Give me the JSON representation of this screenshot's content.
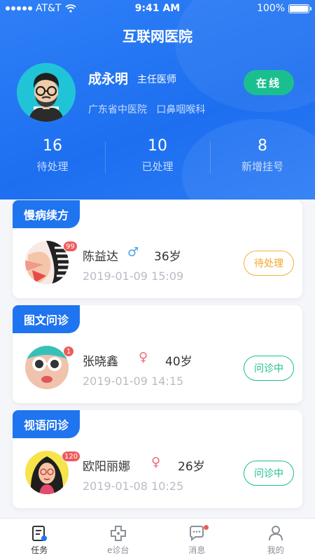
{
  "status_bar": {
    "carrier": "AT&T",
    "time": "9:41 AM",
    "battery": "100%"
  },
  "app": {
    "title": "互联网医院"
  },
  "doctor": {
    "name": "成永明",
    "title": "主任医师",
    "hospital": "广东省中医院",
    "department": "口鼻咽喉科",
    "status_label": "在线"
  },
  "stats": [
    {
      "value": "16",
      "label": "待处理"
    },
    {
      "value": "10",
      "label": "已处理"
    },
    {
      "value": "8",
      "label": "新增挂号"
    }
  ],
  "cards": [
    {
      "category": "慢病续方",
      "badge": "99",
      "name": "陈益达",
      "gender": "♂",
      "gender_color": "#4ea3e8",
      "age": "36岁",
      "datetime": "2019-01-09   15:09",
      "status": "待处理"
    },
    {
      "category": "图文问诊",
      "badge": "1",
      "name": "张晓鑫",
      "gender": "♀",
      "gender_color": "#ef6a7a",
      "age": "40岁",
      "datetime": "2019-01-09   14:15",
      "status": "问诊中"
    },
    {
      "category": "视语问诊",
      "badge": "120",
      "name": "欧阳丽娜",
      "gender": "♀",
      "gender_color": "#ef6a7a",
      "age": "26岁",
      "datetime": "2019-01-08   10:25",
      "status": "问诊中"
    }
  ],
  "tabs": [
    {
      "label": "任务",
      "icon": "task-list-icon"
    },
    {
      "label": "e诊台",
      "icon": "medical-cross-icon"
    },
    {
      "label": "消息",
      "icon": "chat-bubble-icon"
    },
    {
      "label": "我的",
      "icon": "user-profile-icon"
    }
  ],
  "colors": {
    "primary": "#1f74ef",
    "online": "#1bbf8f",
    "pending": "#f3a72a",
    "badge": "#ef5b5b"
  }
}
